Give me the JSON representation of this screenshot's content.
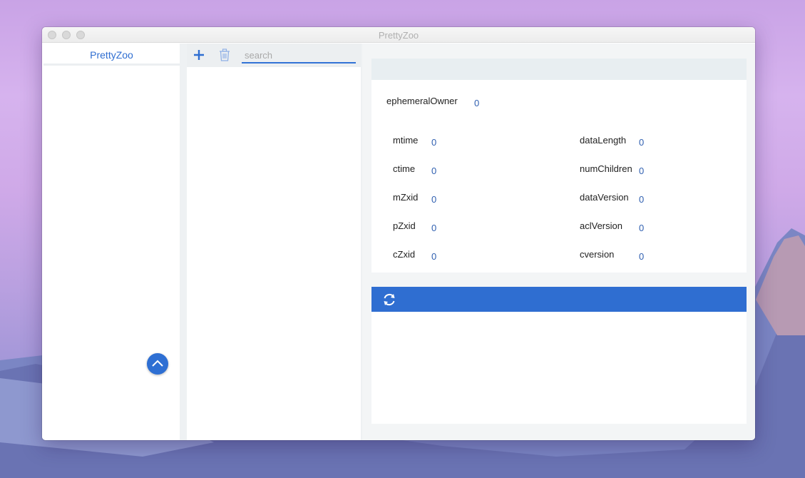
{
  "window": {
    "title": "PrettyZoo"
  },
  "server_panel": {
    "tab_label": "PrettyZoo"
  },
  "tree_panel": {
    "search_placeholder": "search"
  },
  "node_stat": {
    "ephemeralOwner": {
      "label": "ephemeralOwner",
      "value": "0"
    },
    "left": [
      {
        "label": "mtime",
        "value": "0"
      },
      {
        "label": "ctime",
        "value": "0"
      },
      {
        "label": "mZxid",
        "value": "0"
      },
      {
        "label": "pZxid",
        "value": "0"
      },
      {
        "label": "cZxid",
        "value": "0"
      }
    ],
    "right": [
      {
        "label": "dataLength",
        "value": "0"
      },
      {
        "label": "numChildren",
        "value": "0"
      },
      {
        "label": "dataVersion",
        "value": "0"
      },
      {
        "label": "aclVersion",
        "value": "0"
      },
      {
        "label": "cversion",
        "value": "0"
      }
    ]
  },
  "colors": {
    "accent": "#2f6ed1",
    "value_text": "#2f5fb0"
  }
}
